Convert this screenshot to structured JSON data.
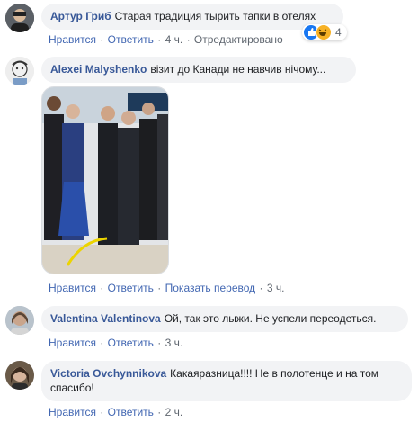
{
  "comments": [
    {
      "author": "Артур Гриб",
      "text": "Старая традиция тырить тапки в отелях",
      "like": "Нравится",
      "reply": "Ответить",
      "time": "4 ч.",
      "edited": "Отредактировано",
      "reaction_count": "4",
      "reactions": [
        "like-reaction-icon",
        "haha-reaction-icon"
      ]
    },
    {
      "author": "Alexei Malyshenko",
      "text": "візит до Канади не навчив нічому...",
      "like": "Нравится",
      "reply": "Ответить",
      "translate": "Показать перевод",
      "time": "3 ч."
    },
    {
      "author": "Valentina Valentinova",
      "text": "Ой, так это лыжи. Не успели переодеться.",
      "like": "Нравится",
      "reply": "Ответить",
      "time": "3 ч."
    },
    {
      "author": "Victoria Ovchynnikova",
      "text": "Какаяразница!!!! Не в полотенце и на том спасибо!",
      "like": "Нравится",
      "reply": "Ответить",
      "time": "2 ч."
    }
  ],
  "separator": "·",
  "colors": {
    "author": "#385898",
    "link": "#4267b2",
    "meta": "#606770",
    "bubble": "#f2f3f5"
  }
}
